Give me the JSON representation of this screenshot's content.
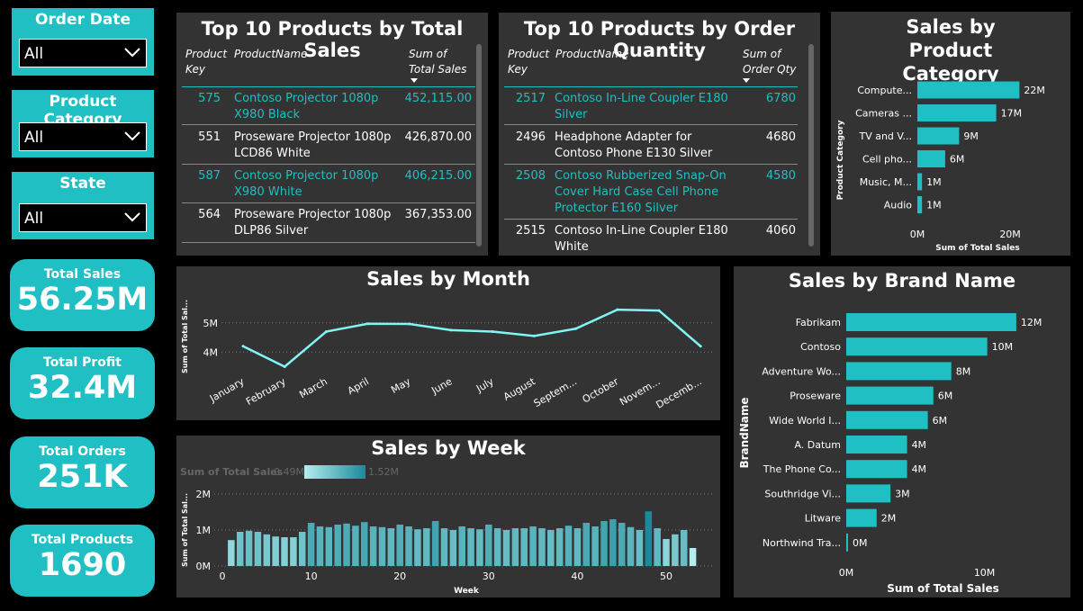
{
  "slicers": [
    {
      "title": "Order Date",
      "value": "All"
    },
    {
      "title": "Product Category",
      "value": "All"
    },
    {
      "title": "State",
      "value": "All"
    }
  ],
  "kpis": [
    {
      "label": "Total Sales",
      "value": "56.25M"
    },
    {
      "label": "Total Profit",
      "value": "32.4M"
    },
    {
      "label": "Total Orders",
      "value": "251K"
    },
    {
      "label": "Total Products",
      "value": "1690"
    }
  ],
  "top_sales": {
    "title": "Top 10 Products by Total Sales",
    "headers": {
      "key": "Product Key",
      "name": "ProductName",
      "value": "Sum of Total Sales"
    },
    "rows": [
      {
        "key": "575",
        "name": "Contoso Projector 1080p X980 Black",
        "value": "452,115.00",
        "highlight": true
      },
      {
        "key": "551",
        "name": "Proseware Projector 1080p LCD86 White",
        "value": "426,870.00",
        "highlight": false
      },
      {
        "key": "587",
        "name": "Contoso Projector 1080p X980 White",
        "value": "406,215.00",
        "highlight": true
      },
      {
        "key": "564",
        "name": "Proseware Projector 1080p DLP86 Silver",
        "value": "367,353.00",
        "highlight": false
      }
    ]
  },
  "top_qty": {
    "title": "Top 10 Products by Order Quantity",
    "headers": {
      "key": "Product Key",
      "name": "ProductName",
      "value": "Sum of Order Qty"
    },
    "rows": [
      {
        "key": "2517",
        "name": "Contoso In-Line Coupler E180 Silver",
        "value": "6780",
        "highlight": true
      },
      {
        "key": "2496",
        "name": "Headphone Adapter for Contoso Phone E130 Silver",
        "value": "4680",
        "highlight": false
      },
      {
        "key": "2508",
        "name": "Contoso Rubberized Snap-On Cover Hard Case Cell Phone Protector E160 Silver",
        "value": "4580",
        "highlight": true
      },
      {
        "key": "2515",
        "name": "Contoso In-Line Coupler E180 White",
        "value": "4060",
        "highlight": false
      }
    ]
  },
  "chart_data": [
    {
      "id": "category",
      "type": "bar",
      "orientation": "horizontal",
      "title": "Sales by Product Category",
      "xlabel": "Sum of Total Sales",
      "ylabel": "Product Category",
      "categories": [
        "Compute...",
        "Cameras ...",
        "TV and V...",
        "Cell pho...",
        "Music, M...",
        "Audio"
      ],
      "values": [
        22,
        17,
        9,
        6,
        1,
        1
      ],
      "labels": [
        "22M",
        "17M",
        "9M",
        "6M",
        "1M",
        "1M"
      ],
      "xticks": [
        "0M",
        "20M"
      ],
      "xlim": [
        0,
        26
      ],
      "color": "#1fbfc4"
    },
    {
      "id": "month",
      "type": "line",
      "title": "Sales by Month",
      "ylabel": "Sum of Total Sal...",
      "categories": [
        "January",
        "February",
        "March",
        "April",
        "May",
        "June",
        "July",
        "August",
        "Septem...",
        "October",
        "Novem...",
        "Decemb..."
      ],
      "values": [
        4.2,
        3.5,
        4.7,
        4.97,
        4.96,
        4.75,
        4.7,
        4.55,
        4.8,
        5.45,
        5.42,
        4.2
      ],
      "yticks": [
        "4M",
        "5M"
      ],
      "ylim": [
        3.3,
        5.7
      ],
      "color": "#7ff5f5"
    },
    {
      "id": "week",
      "type": "bar",
      "title": "Sales by Week",
      "xlabel": "Week",
      "ylabel": "Sum of Total Sal...",
      "legend_title": "Sum of Total Sales",
      "legend_min": "0.49M",
      "legend_max": "1.52M",
      "x": [
        1,
        2,
        3,
        4,
        5,
        6,
        7,
        8,
        9,
        10,
        11,
        12,
        13,
        14,
        15,
        16,
        17,
        18,
        19,
        20,
        21,
        22,
        23,
        24,
        25,
        26,
        27,
        28,
        29,
        30,
        31,
        32,
        33,
        34,
        35,
        36,
        37,
        38,
        39,
        40,
        41,
        42,
        43,
        44,
        45,
        46,
        47,
        48,
        49,
        50,
        51,
        52,
        53
      ],
      "values": [
        0.72,
        0.95,
        0.98,
        0.95,
        0.88,
        0.82,
        0.8,
        0.8,
        0.95,
        1.2,
        1.1,
        1.08,
        1.15,
        1.18,
        1.12,
        1.22,
        1.1,
        1.08,
        1.05,
        1.15,
        1.1,
        1.02,
        1.05,
        1.25,
        1.05,
        1.0,
        1.1,
        1.05,
        1.02,
        1.15,
        1.05,
        1.0,
        1.05,
        1.05,
        1.1,
        1.05,
        1.0,
        1.05,
        1.12,
        1.05,
        1.2,
        1.1,
        1.25,
        1.3,
        1.2,
        1.08,
        1.0,
        1.52,
        1.05,
        0.75,
        0.88,
        1.0,
        0.5
      ],
      "xticks": [
        0,
        10,
        20,
        30,
        40,
        50
      ],
      "yticks": [
        "0M",
        "1M",
        "2M"
      ],
      "ylim": [
        0,
        2
      ],
      "color_min": "#b3eef0",
      "color_max": "#1a8a9a"
    },
    {
      "id": "brand",
      "type": "bar",
      "orientation": "horizontal",
      "title": "Sales by Brand Name",
      "xlabel": "Sum of Total Sales",
      "ylabel": "BrandName",
      "categories": [
        "Fabrikam",
        "Contoso",
        "Adventure Wo...",
        "Proseware",
        "Wide World I...",
        "A. Datum",
        "The Phone Co...",
        "Southridge Vi...",
        "Litware",
        "Northwind Tra..."
      ],
      "values": [
        12.3,
        10.2,
        7.6,
        6.3,
        5.9,
        4.4,
        4.4,
        3.2,
        2.2,
        0.1
      ],
      "labels": [
        "12M",
        "10M",
        "8M",
        "6M",
        "6M",
        "4M",
        "4M",
        "3M",
        "2M",
        "0M"
      ],
      "xticks": [
        "0M",
        "10M"
      ],
      "xlim": [
        0,
        14
      ],
      "color": "#1fbfc4"
    }
  ]
}
